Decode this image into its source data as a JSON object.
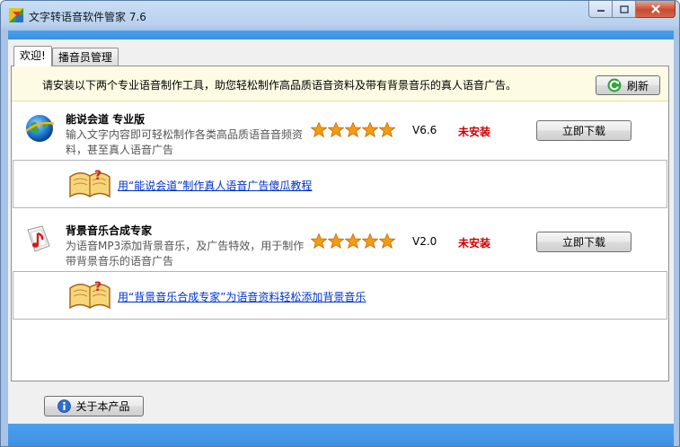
{
  "window": {
    "title": "文字转语音软件管家 7.6",
    "colors": {
      "accent": "#3d8fe0",
      "star": "#f39c12",
      "status_red": "#cc0000",
      "link": "#0033cc"
    }
  },
  "tabs": [
    {
      "label": "欢迎!",
      "active": true
    },
    {
      "label": "播音员管理",
      "active": false
    }
  ],
  "notice": {
    "text": "请安装以下两个专业语音制作工具，助您轻松制作高品质语音资料及带有背景音乐的真人语音广告。",
    "refresh_label": "刷新"
  },
  "products": [
    {
      "name": "能说会道 专业版",
      "desc": "输入文字内容即可轻松制作各类高品质语音音频资料，甚至真人语音广告",
      "rating": 5,
      "version": "V6.6",
      "status": "未安装",
      "download_label": "立即下载",
      "tutorial": "用“能说会道”制作真人语音广告傻瓜教程",
      "icon": "globe-icon"
    },
    {
      "name": "背景音乐合成专家",
      "desc": "为语音MP3添加背景音乐，及广告特效，用于制作带背景音乐的语音广告",
      "rating": 5,
      "version": "V2.0",
      "status": "未安装",
      "download_label": "立即下载",
      "tutorial": "用“背景音乐合成专家”为语音资料轻松添加背景音乐",
      "icon": "music-note-icon"
    }
  ],
  "footer": {
    "about_label": "关于本产品"
  }
}
